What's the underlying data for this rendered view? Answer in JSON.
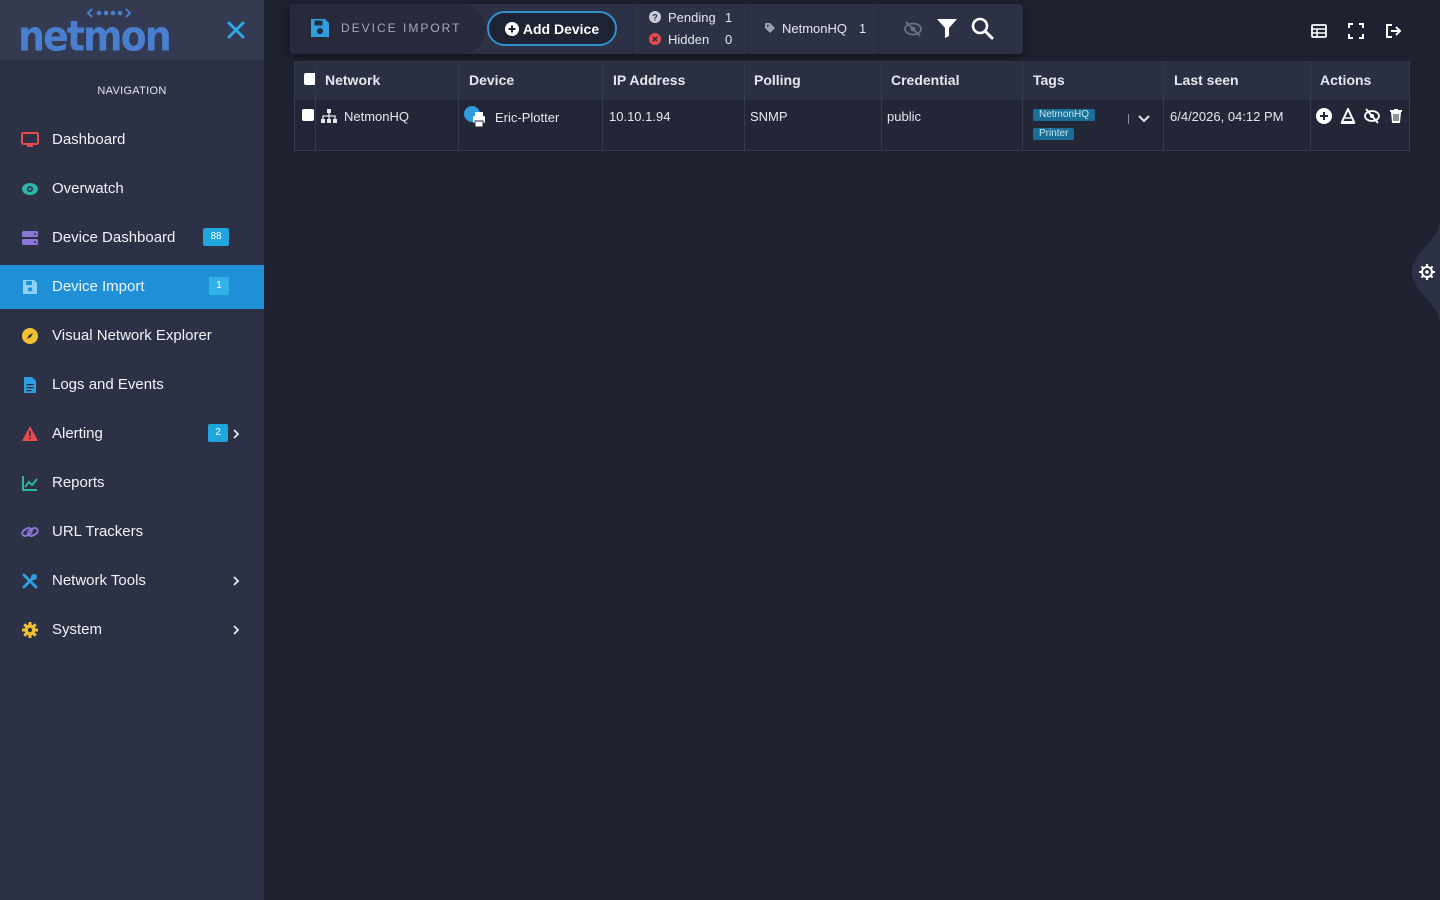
{
  "app": {
    "logo_text": "netmon"
  },
  "sidebar": {
    "heading": "NAVIGATION",
    "items": [
      {
        "label": "Dashboard",
        "badge": "",
        "icon": "monitor-icon",
        "color": "#e84b4b"
      },
      {
        "label": "Overwatch",
        "badge": "",
        "icon": "eye-icon",
        "color": "#2bb5a8"
      },
      {
        "label": "Device Dashboard",
        "badge": "88",
        "icon": "server-icon",
        "color": "#8a77d8"
      },
      {
        "label": "Device Import",
        "badge": "1",
        "icon": "floppy-icon",
        "color": "#2f9ee0",
        "active": true
      },
      {
        "label": "Visual Network Explorer",
        "badge": "",
        "icon": "compass-icon",
        "color": "#f0c232"
      },
      {
        "label": "Logs and Events",
        "badge": "",
        "icon": "document-icon",
        "color": "#2f9ee0"
      },
      {
        "label": "Alerting",
        "badge": "2",
        "icon": "warning-icon",
        "color": "#e84b4b"
      },
      {
        "label": "Reports",
        "badge": "",
        "icon": "chart-line-icon",
        "color": "#2bb5a8"
      },
      {
        "label": "URL Trackers",
        "badge": "",
        "icon": "link-icon",
        "color": "#8a77d8"
      },
      {
        "label": "Network Tools",
        "badge": "",
        "icon": "tools-icon",
        "color": "#2f9ee0"
      },
      {
        "label": "System",
        "badge": "",
        "icon": "gear-icon",
        "color": "#f0c232"
      }
    ]
  },
  "toolbar": {
    "title": "DEVICE IMPORT",
    "add_device_label": "Add Device",
    "pending_label": "Pending",
    "pending_count": "1",
    "hidden_label": "Hidden",
    "hidden_count": "0",
    "network_tag_label": "NetmonHQ",
    "network_tag_count": "1"
  },
  "table": {
    "headers": [
      "Network",
      "Device",
      "IP Address",
      "Polling",
      "Credential",
      "Tags",
      "Last seen",
      "Actions"
    ],
    "rows": [
      {
        "network": "NetmonHQ",
        "device": "Eric-Plotter",
        "ip": "10.10.1.94",
        "polling": "SNMP",
        "credential": "public",
        "tags": [
          "NetmonHQ",
          "Printer"
        ],
        "last_seen": "6/4/2026, 04:12 PM"
      }
    ]
  },
  "colors": {
    "accent": "#1f8fd6",
    "sidebar_bg": "#2c3145",
    "main_bg": "#1e2130"
  }
}
